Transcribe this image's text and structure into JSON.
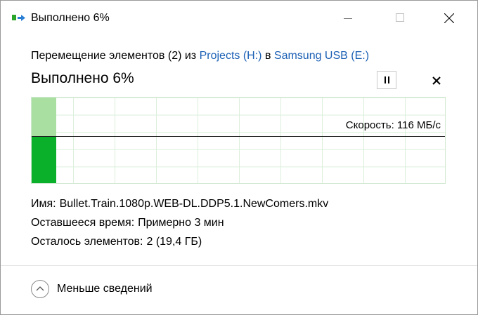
{
  "window": {
    "title": "Выполнено 6%",
    "controls": [
      "minimize",
      "maximize",
      "close"
    ]
  },
  "operation": {
    "prefix": "Перемещение элементов (2) из ",
    "source": "Projects (H:)",
    "middle": " в ",
    "destination": "Samsung USB (E:)"
  },
  "progress": {
    "title": "Выполнено 6%",
    "percent": 6,
    "speed_label": "Скорость: 116 МБ/с",
    "speed_level": 0.55
  },
  "details": {
    "name_label": "Имя:",
    "name_value": "Bullet.Train.1080p.WEB-DL.DDP5.1.NewComers.mkv",
    "time_label": "Оставшееся время:",
    "time_value": "Примерно 3 мин",
    "items_label": "Осталось элементов:",
    "items_value": "2 (19,4 ГБ)"
  },
  "footer": {
    "toggle_label": "Меньше сведений"
  },
  "colors": {
    "link": "#1a5fb4",
    "progress_done": "#0aaf2a",
    "progress_light": "#a9e0a1",
    "grid": "#dcefdc"
  },
  "icons": {
    "app": "move-files-icon",
    "pause": "pause-icon",
    "cancel": "close-icon",
    "toggle": "chevron-up-icon"
  }
}
